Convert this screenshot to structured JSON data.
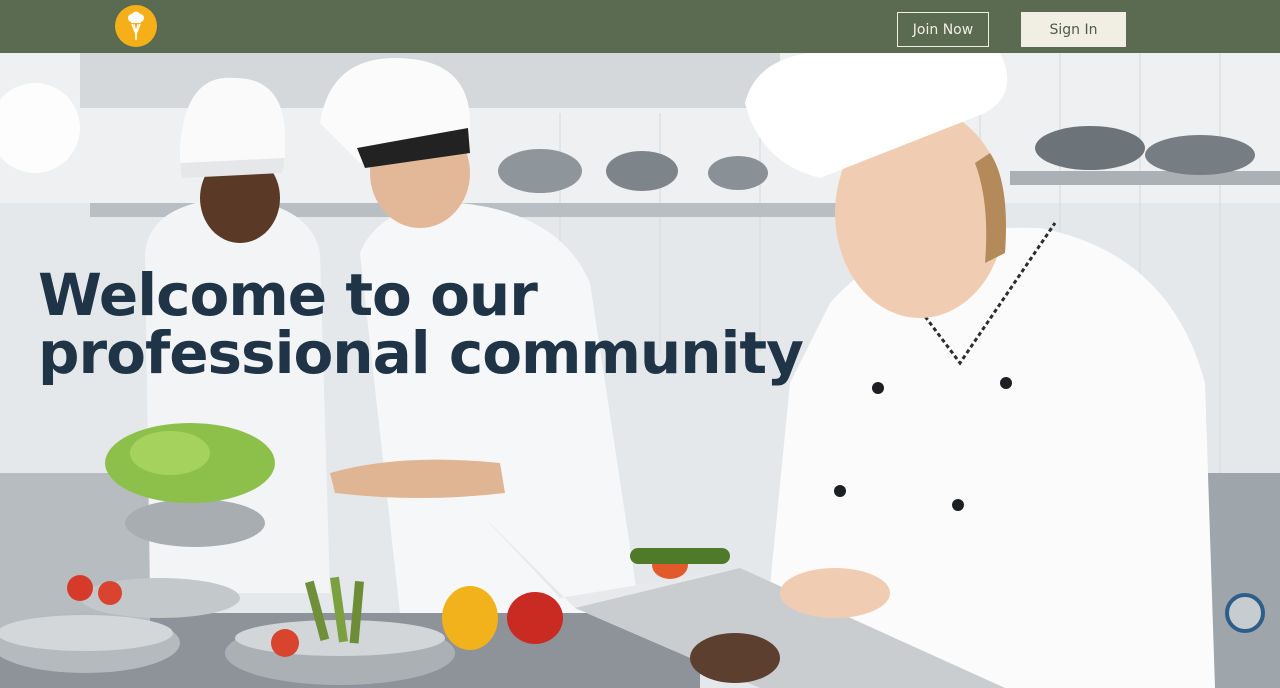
{
  "header": {
    "logo_icon": "chef-whisk-logo-icon",
    "join_label": "Join Now",
    "signin_label": "Sign In"
  },
  "hero": {
    "headline_line1": "Welcome to our",
    "headline_line2": "professional community",
    "image": "chefs-in-kitchen-photo"
  },
  "colors": {
    "nav_bg": "#5a6b52",
    "logo_bg": "#f5b019",
    "signin_bg": "#f1efe4",
    "headline": "#1f3447"
  }
}
